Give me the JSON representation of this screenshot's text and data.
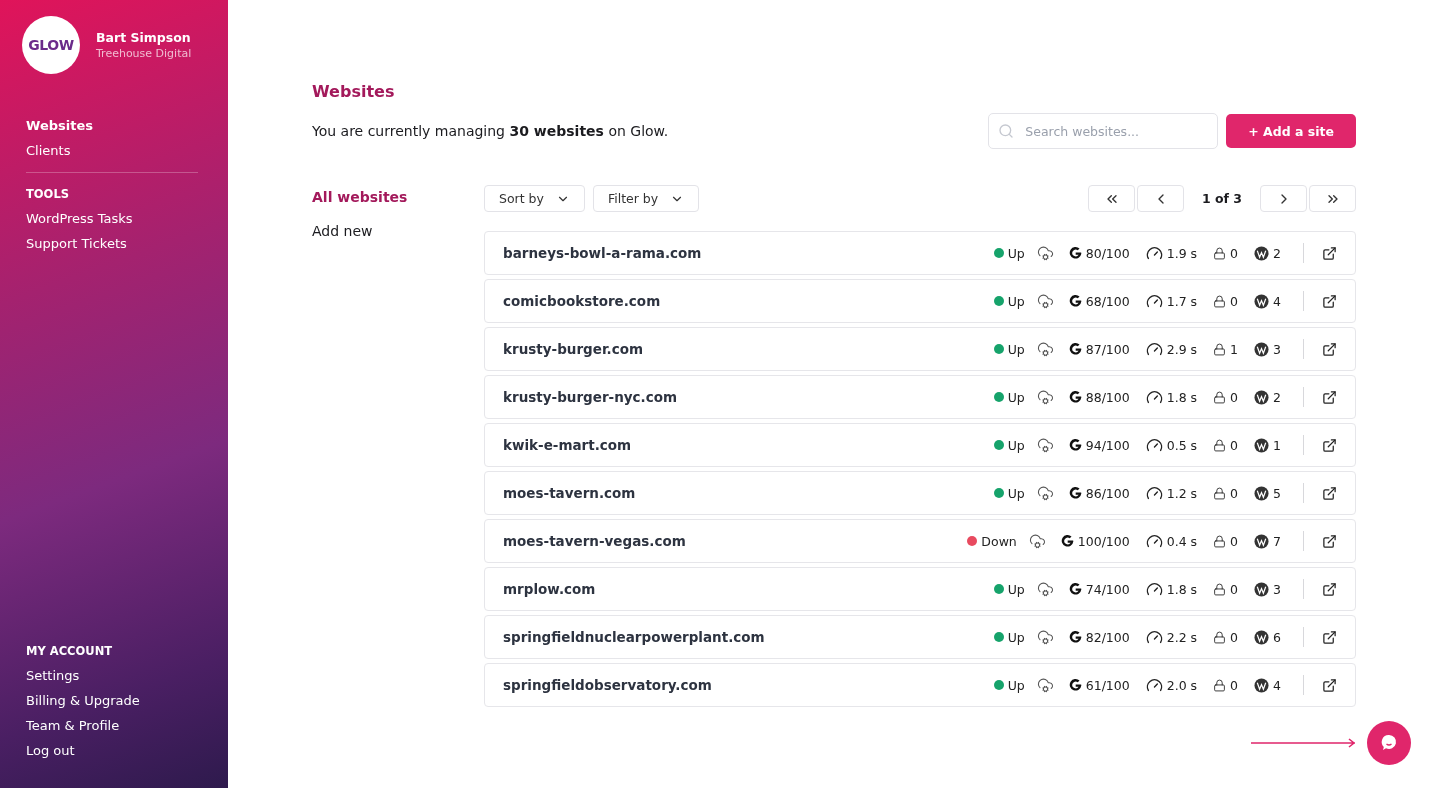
{
  "sidebar": {
    "logo": "GLOW",
    "user": {
      "name": "Bart Simpson",
      "company": "Treehouse Digital"
    },
    "nav": [
      {
        "label": "Websites",
        "selected": true
      },
      {
        "label": "Clients",
        "selected": false
      }
    ],
    "tools": {
      "heading": "TOOLS",
      "items": [
        {
          "label": "WordPress Tasks",
          "selected": false
        },
        {
          "label": "Support Tickets",
          "selected": false
        }
      ]
    },
    "account": {
      "heading": "MY ACCOUNT",
      "items": [
        {
          "label": "Settings",
          "selected": false
        },
        {
          "label": "Billing & Upgrade",
          "selected": false
        },
        {
          "label": "Team & Profile",
          "selected": false
        },
        {
          "label": "Log out",
          "selected": false
        }
      ]
    }
  },
  "page": {
    "title": "Websites",
    "summary": "You are currently managing **30 websites** on Glow.",
    "search": {
      "placeholder": "Search websites..."
    },
    "add_button": "+ Add a site"
  },
  "subnav": [
    {
      "label": "All websites",
      "selected": true
    },
    {
      "label": "Add new",
      "selected": false
    }
  ],
  "toolbar": {
    "sort": "Sort by",
    "filter": "Filter by",
    "page_label": "1 of 3"
  },
  "sites": [
    {
      "domain": "barneys-bowl-a-rama.com",
      "up": true,
      "status": "Up",
      "score": "80/100",
      "speed": "1.9 s",
      "locks": "0",
      "updates": "2"
    },
    {
      "domain": "comicbookstore.com",
      "up": true,
      "status": "Up",
      "score": "68/100",
      "speed": "1.7 s",
      "locks": "0",
      "updates": "4"
    },
    {
      "domain": "krusty-burger.com",
      "up": true,
      "status": "Up",
      "score": "87/100",
      "speed": "2.9 s",
      "locks": "1",
      "updates": "3"
    },
    {
      "domain": "krusty-burger-nyc.com",
      "up": true,
      "status": "Up",
      "score": "88/100",
      "speed": "1.8 s",
      "locks": "0",
      "updates": "2"
    },
    {
      "domain": "kwik-e-mart.com",
      "up": true,
      "status": "Up",
      "score": "94/100",
      "speed": "0.5 s",
      "locks": "0",
      "updates": "1"
    },
    {
      "domain": "moes-tavern.com",
      "up": true,
      "status": "Up",
      "score": "86/100",
      "speed": "1.2 s",
      "locks": "0",
      "updates": "5"
    },
    {
      "domain": "moes-tavern-vegas.com",
      "up": false,
      "status": "Down",
      "score": "100/100",
      "speed": "0.4 s",
      "locks": "0",
      "updates": "7"
    },
    {
      "domain": "mrplow.com",
      "up": true,
      "status": "Up",
      "score": "74/100",
      "speed": "1.8 s",
      "locks": "0",
      "updates": "3"
    },
    {
      "domain": "springfieldnuclearpowerplant.com",
      "up": true,
      "status": "Up",
      "score": "82/100",
      "speed": "2.2 s",
      "locks": "0",
      "updates": "6"
    },
    {
      "domain": "springfieldobservatory.com",
      "up": true,
      "status": "Up",
      "score": "61/100",
      "speed": "2.0 s",
      "locks": "0",
      "updates": "4"
    }
  ]
}
